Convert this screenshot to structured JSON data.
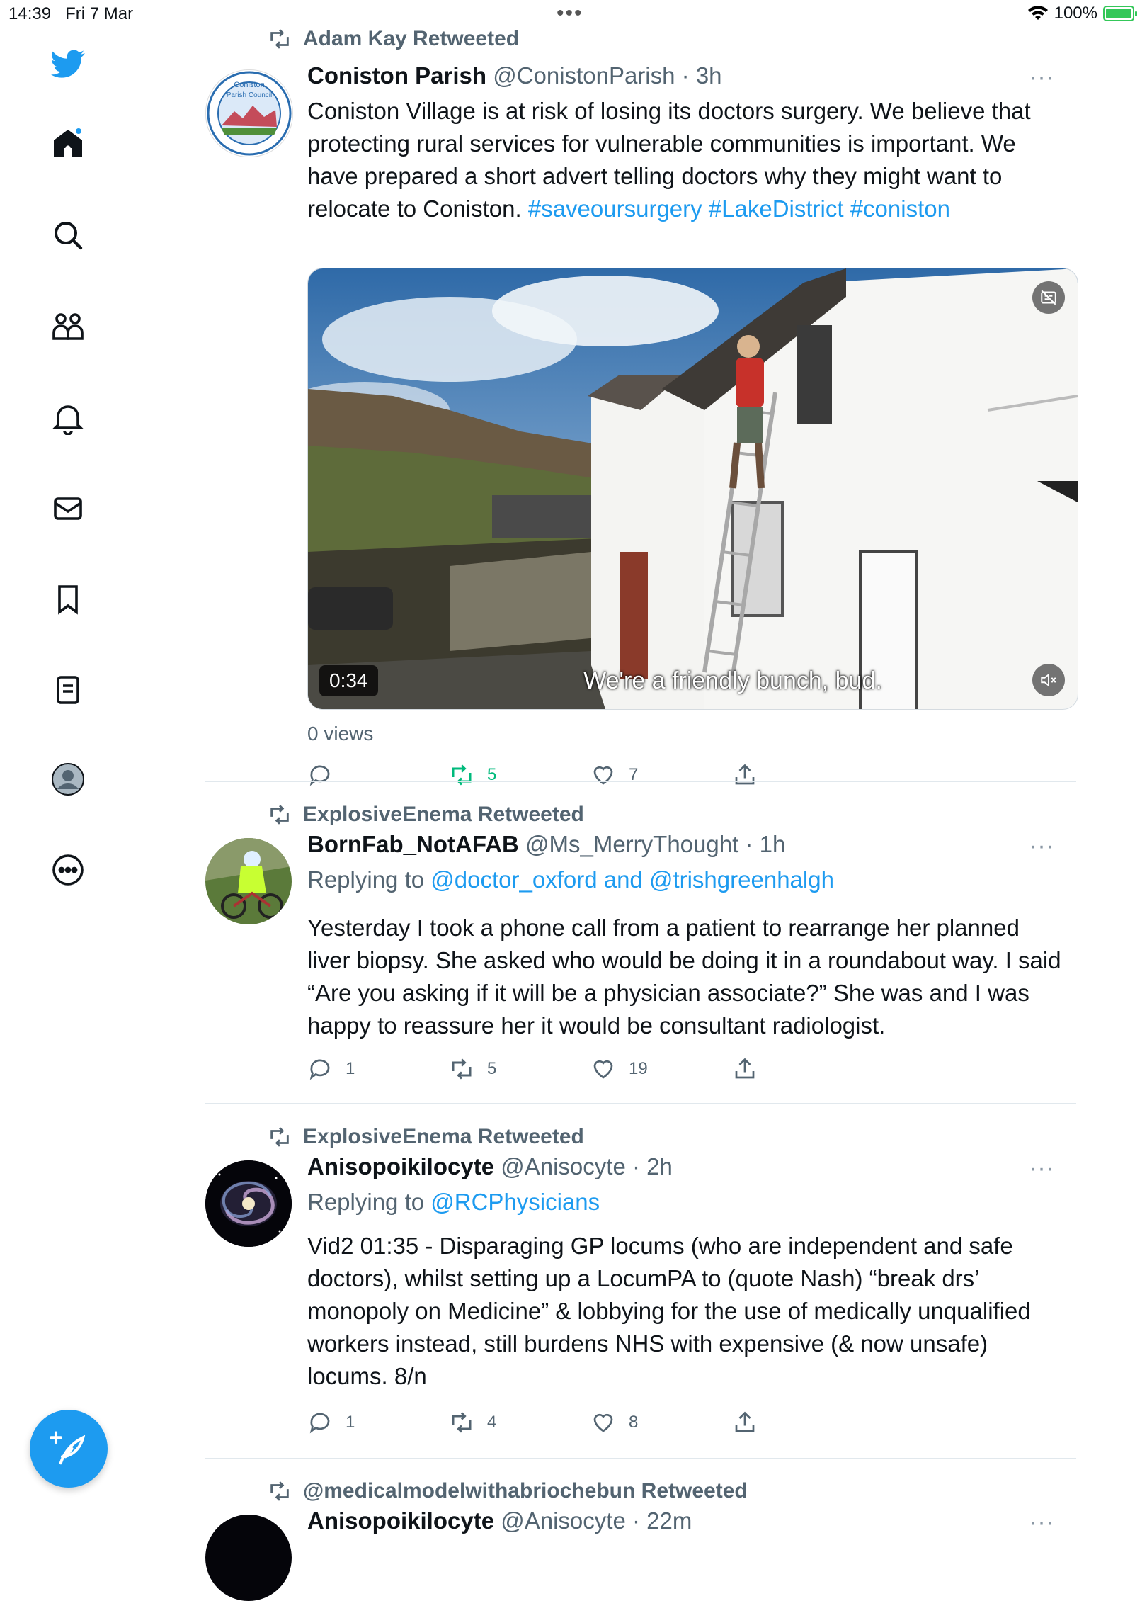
{
  "status_bar": {
    "time": "14:39",
    "date": "Fri 7 Mar",
    "battery": "100%"
  },
  "sidebar": {
    "items": [
      "twitter-logo",
      "home-icon",
      "search-icon",
      "communities-icon",
      "notifications-icon",
      "messages-icon",
      "bookmarks-icon",
      "lists-icon",
      "profile-icon",
      "more-icon"
    ],
    "compose_icon": "compose-icon",
    "accent_color": "#1d9bf0"
  },
  "tweets": [
    {
      "retweeted_by": "Adam Kay Retweeted",
      "name": "Coniston Parish",
      "handle": "@ConistonParish",
      "time": "· 3h",
      "text_plain": "Coniston Village is at risk of losing its doctors surgery.  We believe that protecting rural services for vulnerable communities is important.  We have prepared a short advert telling doctors why they might want to relocate to Coniston.",
      "hashtags": "#saveoursurgery #LakeDistrict #coniston",
      "avatar_text_1": "Coniston",
      "avatar_text_2": "Parish Council",
      "video": {
        "duration": "0:34",
        "caption": "We're a friendly bunch, bud."
      },
      "views": "0 views",
      "replies": "",
      "retweets": "5",
      "likes": "7"
    },
    {
      "retweeted_by": "ExplosiveEnema Retweeted",
      "name": "BornFab_NotAFAB",
      "handle": "@Ms_MerryThought",
      "time": "· 1h",
      "replying_prefix": "Replying to ",
      "replying_to": "@doctor_oxford and @trishgreenhalgh",
      "text": "Yesterday I took a phone call from a patient to rearrange her planned liver biopsy. She asked who would be doing it in a roundabout way. I said “Are you asking if it will be a physician associate?” She was and I was happy to reassure her it would be consultant radiologist.",
      "replies": "1",
      "retweets": "5",
      "likes": "19"
    },
    {
      "retweeted_by": "ExplosiveEnema Retweeted",
      "name": "Anisopoikilocyte",
      "handle": "@Anisocyte",
      "time": "· 2h",
      "replying_prefix": "Replying to ",
      "replying_to": "@RCPhysicians",
      "text": "Vid2 01:35 - Disparaging GP locums (who are independent and safe doctors), whilst setting up a LocumPA to (quote Nash) “break drs’ monopoly on Medicine” & lobbying for the use of medically unqualified workers instead, still burdens NHS with expensive (& now unsafe) locums. 8/n",
      "replies": "1",
      "retweets": "4",
      "likes": "8"
    },
    {
      "retweeted_by": "@medicalmodelwithabriochebun Retweeted",
      "name": "Anisopoikilocyte",
      "handle": "@Anisocyte",
      "time": "· 22m"
    }
  ]
}
